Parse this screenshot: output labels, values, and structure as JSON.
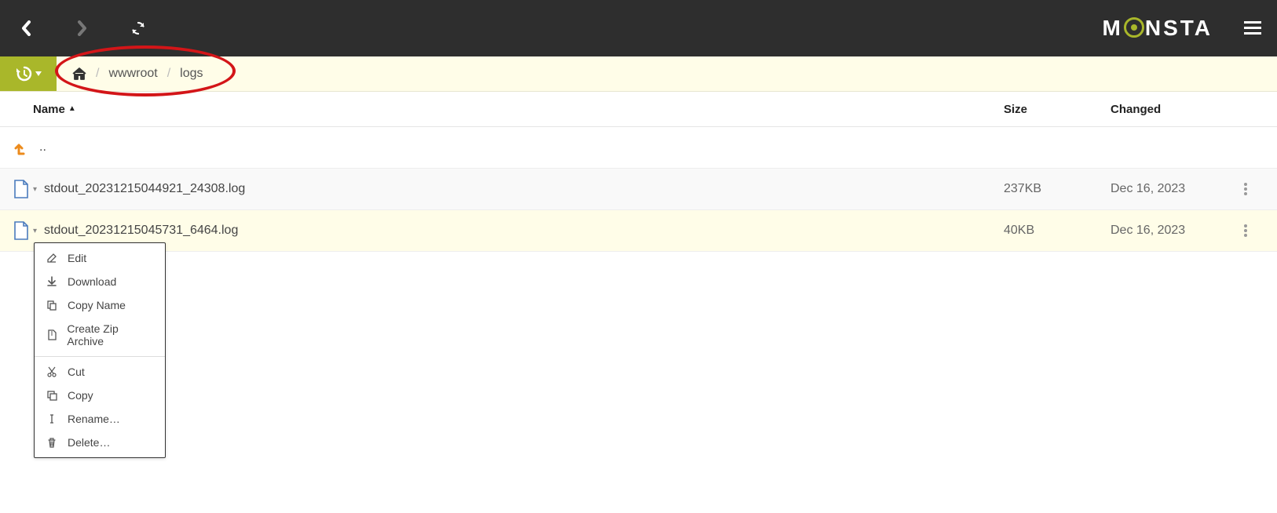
{
  "brand": "MONSTA",
  "breadcrumbs": {
    "items": [
      "wwwroot",
      "logs"
    ]
  },
  "columns": {
    "name": "Name",
    "size": "Size",
    "changed": "Changed"
  },
  "up_label": "..",
  "files": [
    {
      "name": "stdout_20231215044921_24308.log",
      "size": "237KB",
      "changed": "Dec 16, 2023"
    },
    {
      "name": "stdout_20231215045731_6464.log",
      "size": "40KB",
      "changed": "Dec 16, 2023"
    }
  ],
  "context_menu": {
    "group1": [
      {
        "icon": "edit",
        "label": "Edit"
      },
      {
        "icon": "download",
        "label": "Download"
      },
      {
        "icon": "copyname",
        "label": "Copy Name"
      },
      {
        "icon": "zip",
        "label": "Create Zip Archive"
      }
    ],
    "group2": [
      {
        "icon": "cut",
        "label": "Cut"
      },
      {
        "icon": "copy",
        "label": "Copy"
      },
      {
        "icon": "rename",
        "label": "Rename…"
      },
      {
        "icon": "delete",
        "label": "Delete…"
      }
    ]
  }
}
